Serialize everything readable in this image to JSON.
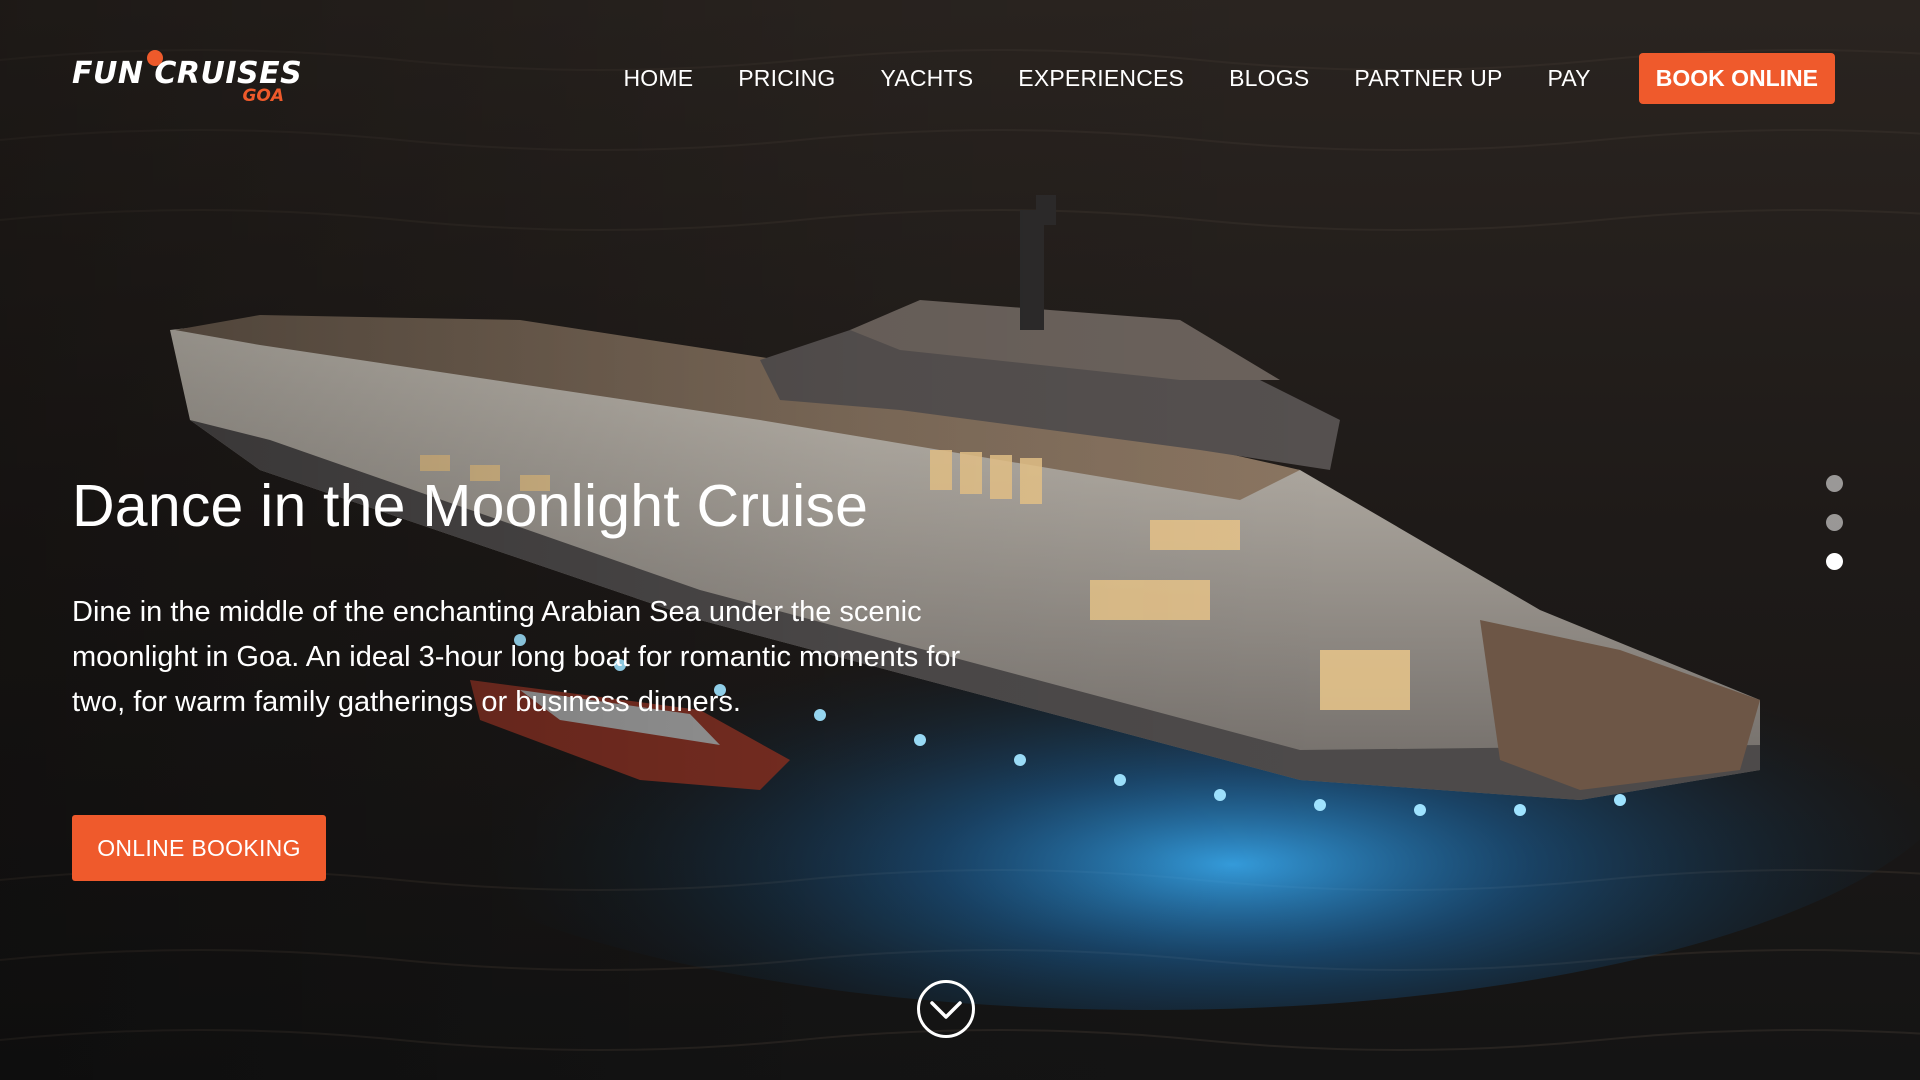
{
  "brand": {
    "main": "FUN CRUISES",
    "sub": "GOA",
    "accent_color": "#ef5a2c"
  },
  "nav": {
    "items": [
      {
        "label": "HOME"
      },
      {
        "label": "PRICING"
      },
      {
        "label": "YACHTS"
      },
      {
        "label": "EXPERIENCES"
      },
      {
        "label": "BLOGS"
      },
      {
        "label": "PARTNER UP"
      },
      {
        "label": "PAY"
      }
    ],
    "book_label": "BOOK ONLINE"
  },
  "hero": {
    "title": "Dance in the Moonlight Cruise",
    "description": "Dine in the middle of the enchanting Arabian Sea under the scenic moonlight in Goa. An ideal 3-hour long boat for romantic moments for two, for warm family gatherings or business dinners.",
    "cta_label": "ONLINE BOOKING"
  },
  "slider": {
    "total": 3,
    "active_index": 3
  },
  "icons": {
    "scroll": "chevron-down-circle-icon",
    "logo_mark": "sun-icon"
  }
}
